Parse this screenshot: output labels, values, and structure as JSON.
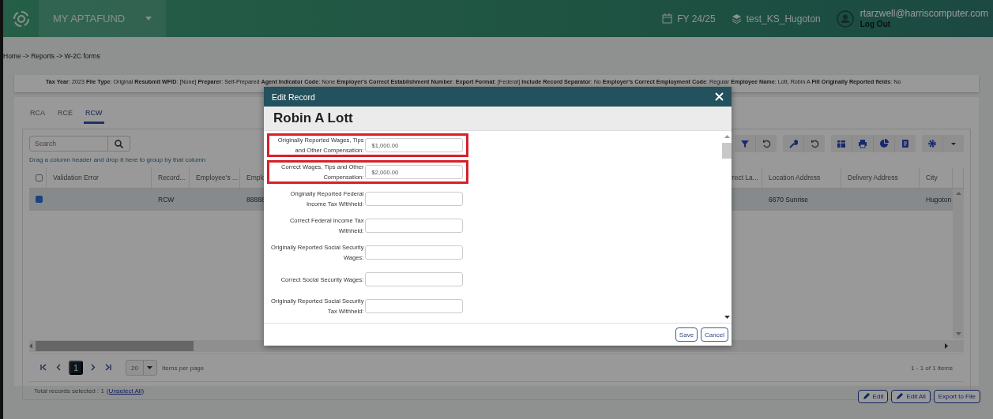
{
  "header": {
    "app_name": "MY APTAFUND",
    "fiscal_year": "FY 24/25",
    "database": "test_KS_Hugoton",
    "user_email": "rtarzwell@harriscomputer.com",
    "logout": "Log Out"
  },
  "breadcrumb": "Home -> Reports -> W-2C forms",
  "summary": "**Tax Year**: 2023 **File Type**: Original **Resubmit WFID**: [None] **Preparer**: Self-Prepared **Agent Indicator Code**: None **Employer's Correct Establishment Number**: **Export Format**: [Federal] **Include Record Separator**: No **Employer's Correct Employment Code**: Regular **Employee Name**: Lott, Robin A **Fill Originally Reported fields**: No",
  "tabs": [
    {
      "label": "RCA",
      "selected": false
    },
    {
      "label": "RCE",
      "selected": false
    },
    {
      "label": "RCW",
      "selected": true
    }
  ],
  "grid": {
    "search": {
      "placeholder": "Search"
    },
    "group_hint": "Drag a column header and drop it here to group by that column",
    "select_all": {
      "checked": false
    },
    "columns": [
      "Validation Error",
      "Record...",
      "Employee's ...",
      "Emplo",
      "rrect La...",
      "Location Address",
      "Delivery Address",
      "City"
    ],
    "rows": [
      {
        "checked": true,
        "cells": [
          null,
          "RCW",
          null,
          "88888",
          null,
          "6670 Sunrise",
          null,
          "Hugoton"
        ]
      }
    ]
  },
  "pager": {
    "pages": [
      {
        "label": "1",
        "selected": true
      }
    ],
    "page_size": "20",
    "page_size_label": "Items per page",
    "range": "1 - 1 of 1 items"
  },
  "selection": {
    "text": "Total records selected : 1",
    "link": "(Unselect All)"
  },
  "actions": [
    {
      "label": "Edit",
      "icon": true
    },
    {
      "label": "Edit All",
      "icon": true
    },
    {
      "label": "Export to File",
      "icon": false
    }
  ],
  "modal": {
    "title": "Edit Record",
    "name": "Robin A Lott",
    "fields": [
      {
        "label": "Originally Reported Wages, Tips and Other Compensation:",
        "value": "$1,000.00",
        "highlighted": true
      },
      {
        "label": "Correct Wages, Tips and Other Compensation:",
        "value": "$2,000.00",
        "highlighted": true
      },
      {
        "label": "Originally Reported Federal Income Tax Withheld:",
        "highlighted": false
      },
      {
        "label": "Correct Federal Income Tax Withheld:",
        "highlighted": false
      },
      {
        "label": "Originally Reported Social Security Wages:",
        "highlighted": false
      },
      {
        "label": "Correct Social Security Wages:",
        "highlighted": false
      },
      {
        "label": "Originally Reported Social Security Tax Withheld:",
        "highlighted": false
      }
    ],
    "buttons": [
      "Save",
      "Cancel"
    ]
  }
}
